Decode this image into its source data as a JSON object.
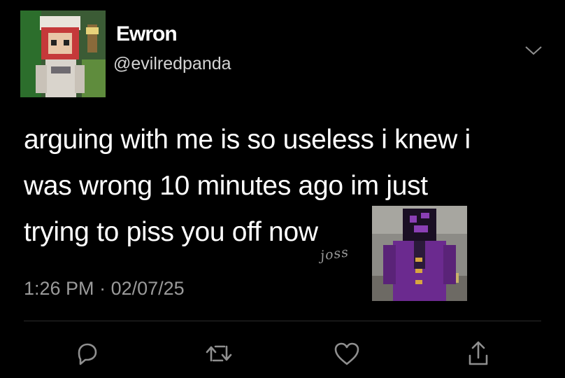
{
  "tweet": {
    "display_name": "Ewron",
    "handle": "@evilredpanda",
    "text_lines": [
      "arguing with me is so useless i knew i",
      "was wrong 10 minutes ago im just",
      "trying to piss you off now"
    ],
    "signature": "joss",
    "time": "1:26 PM",
    "separator": "·",
    "date": "02/07/25"
  },
  "actions": [
    "reply-icon",
    "retweet-icon",
    "like-icon",
    "share-icon"
  ],
  "colors": {
    "background": "#000000",
    "text": "#ffffff",
    "secondary_text": "#9a9a9a",
    "icon": "#8f8f8f",
    "divider": "#2c2c2c"
  }
}
